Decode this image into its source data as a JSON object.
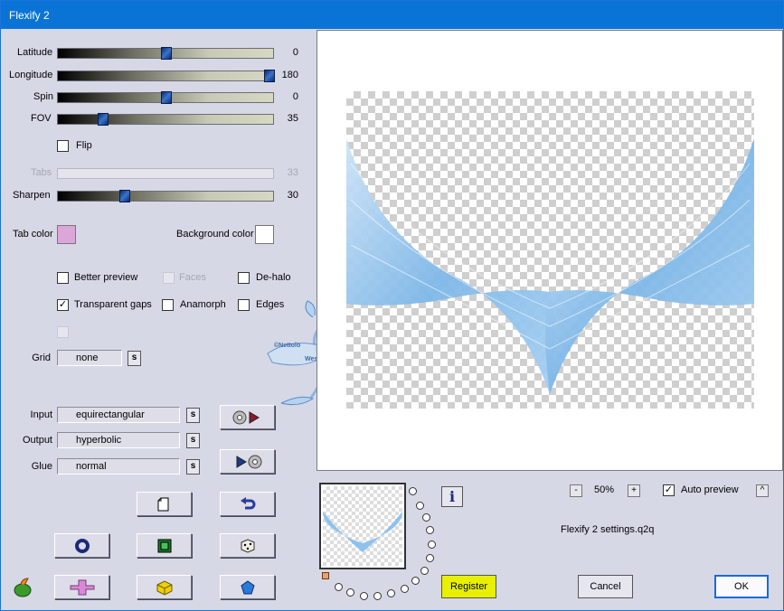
{
  "window": {
    "title": "Flexify 2"
  },
  "sliders": [
    {
      "id": "latitude",
      "label": "Latitude",
      "value": "0",
      "fraction": 0.5,
      "disabled": false
    },
    {
      "id": "longitude",
      "label": "Longitude",
      "value": "180",
      "fraction": 1.0,
      "disabled": false
    },
    {
      "id": "spin",
      "label": "Spin",
      "value": "0",
      "fraction": 0.5,
      "disabled": false
    },
    {
      "id": "fov",
      "label": "FOV",
      "value": "35",
      "fraction": 0.21,
      "disabled": false
    },
    {
      "id": "tabs",
      "label": "Tabs",
      "value": "33",
      "fraction": 0.0,
      "disabled": true
    },
    {
      "id": "sharpen",
      "label": "Sharpen",
      "value": "30",
      "fraction": 0.31,
      "disabled": false
    }
  ],
  "flip": {
    "label": "Flip",
    "checked": false
  },
  "colors": {
    "tab_label": "Tab color",
    "tab_value": "#dba6d8",
    "bg_label": "Background color",
    "bg_value": "#ffffff"
  },
  "options": {
    "better_preview": {
      "label": "Better preview",
      "checked": false
    },
    "faces": {
      "label": "Faces",
      "checked": false,
      "disabled": true
    },
    "dehalo": {
      "label": "De-halo",
      "checked": false
    },
    "transparent_gaps": {
      "label": "Transparent gaps",
      "checked": true
    },
    "anamorph": {
      "label": "Anamorph",
      "checked": false
    },
    "edges": {
      "label": "Edges",
      "checked": false
    },
    "check_mark": "✓"
  },
  "grid": {
    "label": "Grid",
    "value": "none",
    "s": "s"
  },
  "projections": {
    "input": {
      "label": "Input",
      "value": "equirectangular",
      "s": "s"
    },
    "output": {
      "label": "Output",
      "value": "hyperbolic",
      "s": "s"
    },
    "glue": {
      "label": "Glue",
      "value": "normal",
      "s": "s"
    }
  },
  "zoom": {
    "minus": "-",
    "value": "50%",
    "plus": "+"
  },
  "auto_preview": {
    "label": "Auto preview",
    "checked": true,
    "arrow": "^"
  },
  "info": "i",
  "settings_file": "Flexify 2 settings.q2q",
  "buttons": {
    "register": "Register",
    "cancel": "Cancel",
    "ok": "OK"
  },
  "watermark": {
    "line1": "©Nettolo",
    "line2": "Wess"
  },
  "accent": {
    "title_bar": "#0a74d6",
    "register": "#e8f000",
    "wave": "#7fb8e8"
  }
}
